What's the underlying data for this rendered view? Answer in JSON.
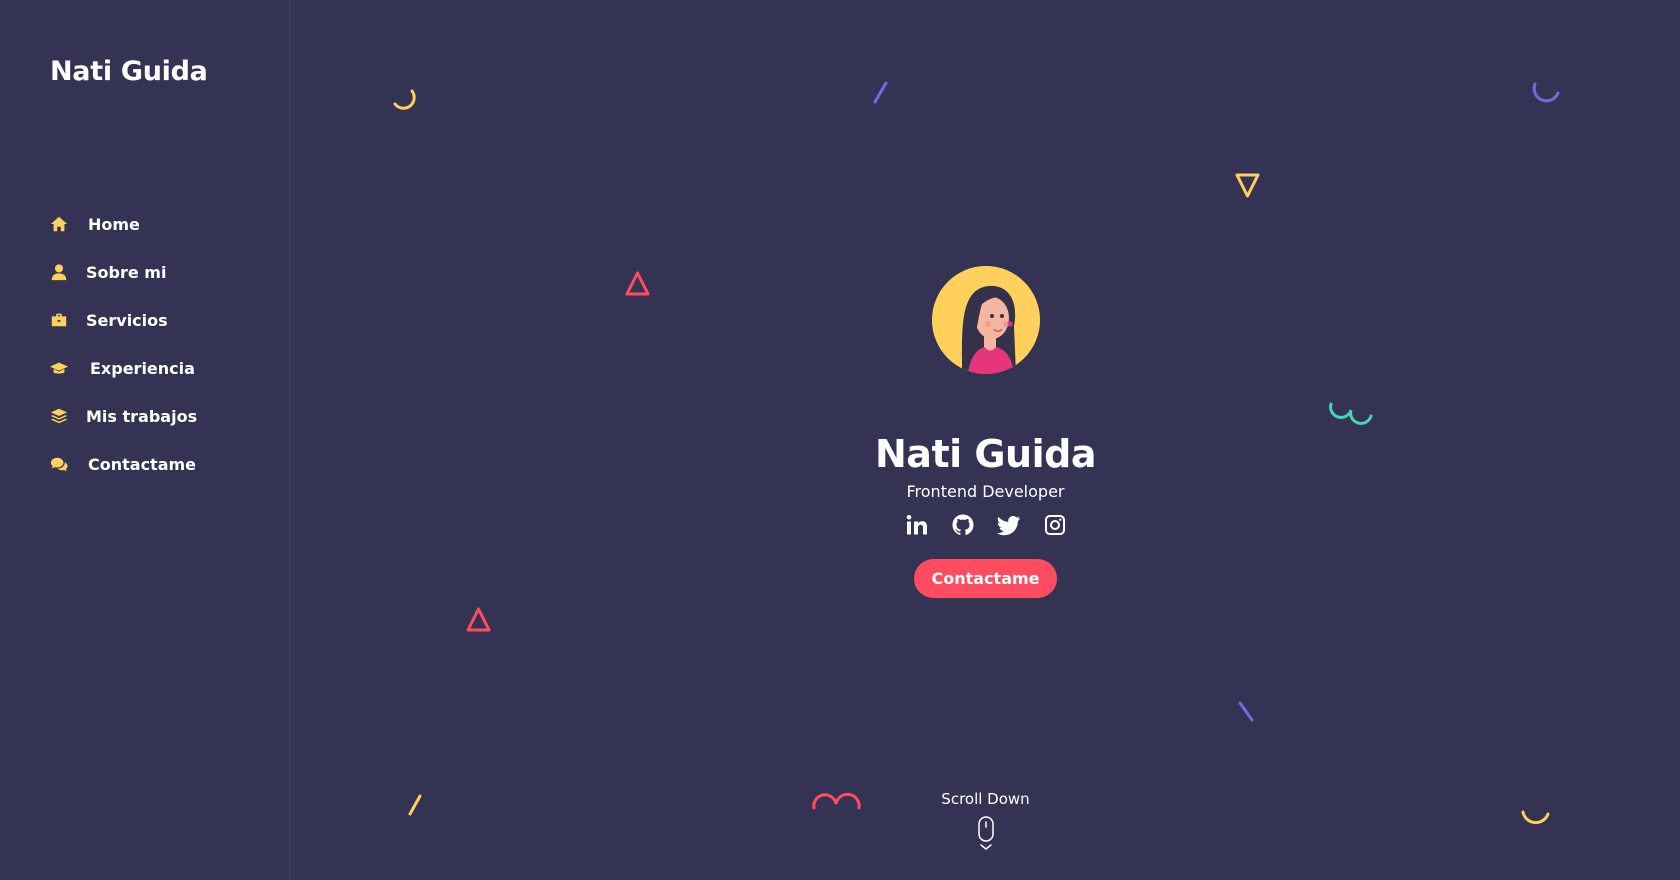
{
  "sidebar": {
    "brand": "Nati Guida",
    "items": [
      {
        "label": "Home",
        "icon": "home-icon"
      },
      {
        "label": "Sobre mi",
        "icon": "user-icon"
      },
      {
        "label": "Servicios",
        "icon": "briefcase-icon"
      },
      {
        "label": "Experiencia",
        "icon": "graduation-cap-icon"
      },
      {
        "label": "Mis trabajos",
        "icon": "layers-icon"
      },
      {
        "label": "Contactame",
        "icon": "chat-icon"
      }
    ]
  },
  "hero": {
    "name": "Nati Guida",
    "role": "Frontend Developer",
    "socials": [
      "linkedin-icon",
      "github-icon",
      "twitter-icon",
      "instagram-icon"
    ],
    "cta_label": "Contactame"
  },
  "scroll": {
    "label": "Scroll Down"
  },
  "colors": {
    "background": "#353353",
    "accent": "#ff4c60",
    "yellow": "#ffd15c",
    "purple": "#6c6ce5",
    "green": "#44d7b6"
  }
}
